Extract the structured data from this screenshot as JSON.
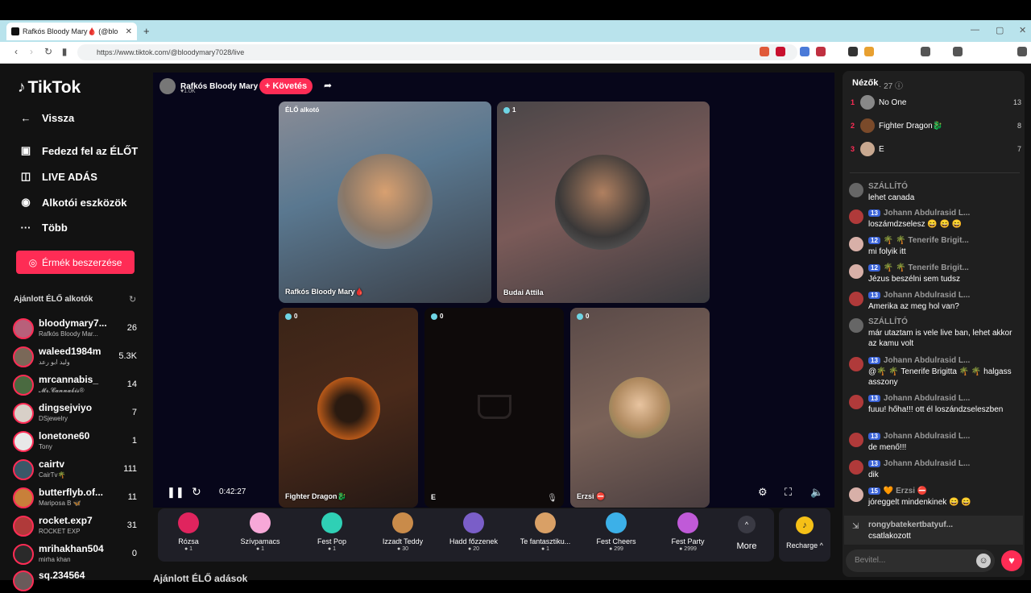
{
  "browser": {
    "tab_title": "Rafkós Bloody Mary🩸 (@blo",
    "url": "https://www.tiktok.com/@bloodymary7028/live"
  },
  "sidebar": {
    "logo": "TikTok",
    "nav": [
      {
        "label": "Vissza",
        "icon": "back-arrow-icon"
      },
      {
        "label": "Fedezd fel az ÉLŐT",
        "icon": "live-explore-icon"
      },
      {
        "label": "LIVE ADÁS",
        "icon": "camera-icon"
      },
      {
        "label": "Alkotói eszközök",
        "icon": "lightbulb-icon"
      },
      {
        "label": "Több",
        "icon": "more-icon"
      }
    ],
    "coins_button": "Érmék beszerzése",
    "recommended_title": "Ajánlott ÉLŐ alkotók",
    "recommended": [
      {
        "name": "bloodymary7...",
        "sub": "Rafkós Bloody Mar...",
        "count": "26"
      },
      {
        "name": "waleed1984m",
        "sub": "وليد ابو رعد",
        "count": "5.3K"
      },
      {
        "name": "mrcannabis_",
        "sub": "𝓜𝓻.𝓒𝓪𝓷𝓷𝓪𝓫𝓲𝓼®",
        "count": "14"
      },
      {
        "name": "dingsejviyo",
        "sub": "DSjewelry",
        "count": "7"
      },
      {
        "name": "lonetone60",
        "sub": "Tony",
        "count": "1"
      },
      {
        "name": "cairtv",
        "sub": "CairTv🌴",
        "count": "111"
      },
      {
        "name": "butterflyb.of...",
        "sub": "Mariposa B 🦋",
        "count": "11"
      },
      {
        "name": "rocket.exp7",
        "sub": "ROCKET EXP",
        "count": "31"
      },
      {
        "name": "mrihakhan504",
        "sub": "mirha khan",
        "count": "0"
      },
      {
        "name": "sq.234564",
        "sub": "",
        "count": ""
      }
    ]
  },
  "stream": {
    "host_name": "Rafkós Bloody Mary🩸",
    "host_likes": "♥1.0K",
    "follow_label": "+ Követés",
    "tiles": [
      {
        "label": "Rafkós Bloody Mary🩸",
        "badge": "ÉLŐ alkotó"
      },
      {
        "label": "Budai Attila",
        "count": "1"
      },
      {
        "label": "Fighter Dragon🐉",
        "count": "0"
      },
      {
        "label": "E",
        "count": "0"
      },
      {
        "label": "Erzsi ⛔",
        "count": "0"
      }
    ],
    "time": "0:42:27"
  },
  "gifts": [
    {
      "name": "Rózsa",
      "price": "1",
      "color": "#e0245e"
    },
    {
      "name": "Szívpamacs",
      "price": "1",
      "color": "#f7a8d8"
    },
    {
      "name": "Fest Pop",
      "price": "1",
      "color": "#2fd0b5"
    },
    {
      "name": "Izzadt Teddy",
      "price": "30",
      "color": "#c98b4a"
    },
    {
      "name": "Hadd főzzenek",
      "price": "20",
      "color": "#7a5ec8"
    },
    {
      "name": "Te fantasztiku...",
      "price": "1",
      "color": "#d9a066"
    },
    {
      "name": "Fest Cheers",
      "price": "299",
      "color": "#3cb0e8"
    },
    {
      "name": "Fest Party",
      "price": "2999",
      "color": "#c05ad8"
    }
  ],
  "more_label": "More",
  "recharge_label": "Recharge ^",
  "below_title": "Ajánlott ÉLŐ adások",
  "viewers": {
    "title": "Nézők",
    "count": "· 27",
    "list": [
      {
        "rank": "1",
        "name": "No One",
        "score": "13"
      },
      {
        "rank": "2",
        "name": "Fighter Dragon🐉",
        "score": "8"
      },
      {
        "rank": "3",
        "name": "E",
        "score": "7"
      }
    ]
  },
  "chat": [
    {
      "level": "",
      "user": "SZÁLLÍTÓ",
      "text": "lehet canada"
    },
    {
      "level": "13",
      "user": "Johann Abdulrasid L...",
      "text": "loszámdzselesz 😄 😄 😄"
    },
    {
      "level": "12",
      "user": "🌴 🌴 Tenerife Brigit...",
      "text": "mi folyik itt"
    },
    {
      "level": "12",
      "user": "🌴 🌴 Tenerife Brigit...",
      "text": "Jézus beszélni sem tudsz"
    },
    {
      "level": "13",
      "user": "Johann Abdulrasid L...",
      "text": "Amerika az meg hol van?"
    },
    {
      "level": "",
      "user": "SZÁLLÍTÓ",
      "text": "már utaztam is vele live ban, lehet akkor az kamu volt"
    },
    {
      "level": "13",
      "user": "Johann Abdulrasid L...",
      "text": "@🌴 🌴 Tenerife Brigitta 🌴 🌴 halgass asszony"
    },
    {
      "level": "13",
      "user": "Johann Abdulrasid L...",
      "text": "fuuu! hőha!!! ott él loszándzseleszben"
    },
    {
      "level": "13",
      "user": "Johann Abdulrasid L...",
      "text": "de menő!!!"
    },
    {
      "level": "13",
      "user": "Johann Abdulrasid L...",
      "text": "dik"
    },
    {
      "level": "15",
      "user": "🧡 Erzsi ⛔",
      "text": "jóreggelt mindenkinek 😄 😄"
    }
  ],
  "joined": {
    "name": "rongybatekertbatyuf...",
    "text": "csatlakozott"
  },
  "chat_placeholder": "Bevitel..."
}
